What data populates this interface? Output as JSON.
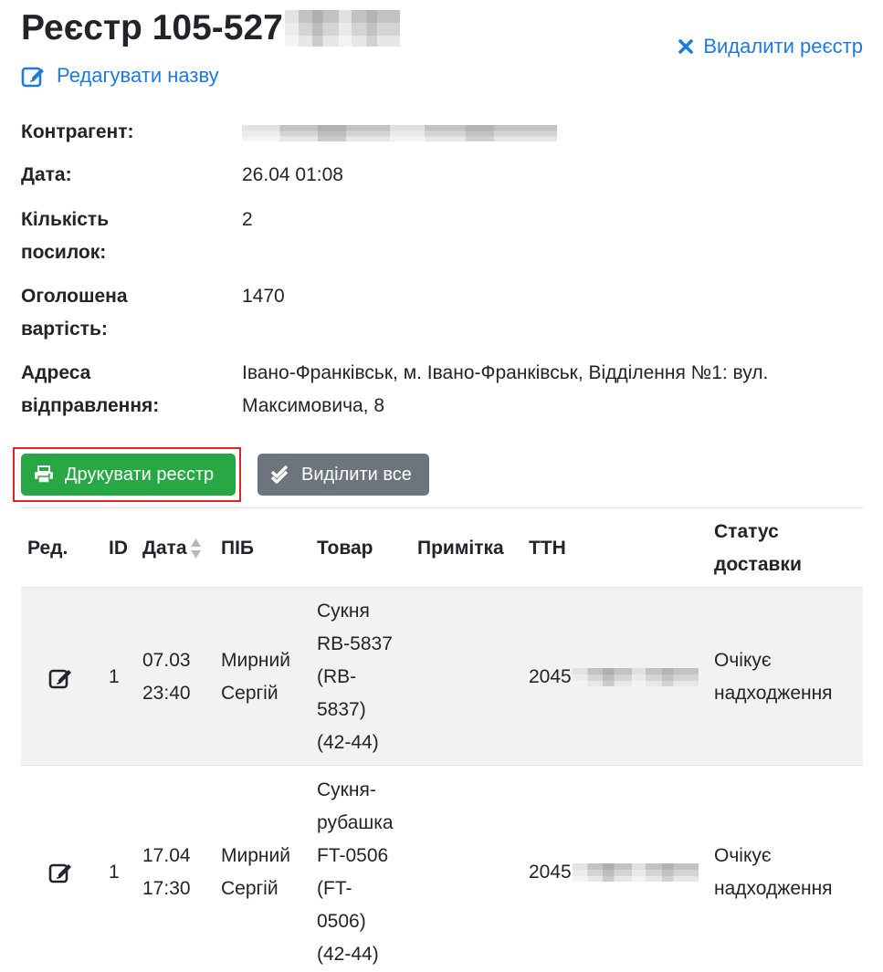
{
  "header": {
    "title_prefix": "Реєстр 105-527",
    "edit_name_label": "Редагувати назву",
    "delete_label": "Видалити реєстр"
  },
  "details": {
    "counterparty_label": "Контрагент:",
    "date_label": "Дата:",
    "date_value": "26.04 01:08",
    "parcels_label_1": "Кількість",
    "parcels_label_2": "посилок:",
    "parcels_value": "2",
    "declared_label_1": "Оголошена",
    "declared_label_2": "вартість:",
    "declared_value": "1470",
    "address_label_1": "Адреса",
    "address_label_2": "відправлення:",
    "address_value_1": "Івано-Франківськ, м. Івано-Франківськ, Відділення №1: вул.",
    "address_value_2": "Максимовича, 8"
  },
  "buttons": {
    "print_label": "Друкувати реєстр",
    "select_all_label": "Виділити все"
  },
  "table": {
    "headers": {
      "edit": "Ред.",
      "id": "ID",
      "date": "Дата",
      "name": "ПІБ",
      "product": "Товар",
      "note": "Примітка",
      "ttn": "ТТН",
      "status_1": "Статус",
      "status_2": "доставки"
    },
    "rows": [
      {
        "id": "1",
        "date_1": "07.03",
        "date_2": "23:40",
        "name_1": "Мирний",
        "name_2": "Сергій",
        "product_lines": [
          "Сукня",
          "RB-5837",
          "(RB-",
          "5837)",
          "(42-44)"
        ],
        "note": "",
        "ttn_prefix": "2045",
        "status_1": "Очікує",
        "status_2": "надходження"
      },
      {
        "id": "1",
        "date_1": "17.04",
        "date_2": "17:30",
        "name_1": "Мирний",
        "name_2": "Сергій",
        "product_lines": [
          "Сукня-",
          "рубашка",
          "FT-0506",
          "(FT-",
          "0506)",
          "(42-44)"
        ],
        "note": "",
        "ttn_prefix": "2045",
        "status_1": "Очікує",
        "status_2": "надходження"
      }
    ]
  },
  "colors": {
    "link": "#1f7ae0",
    "print_button": "#28a745",
    "select_button": "#6c757d",
    "highlight_border": "#e02424",
    "row_stripe": "#f2f2f2"
  },
  "icons": {
    "edit_name": "pen-square-icon",
    "delete": "close-icon",
    "print": "printer-icon",
    "select_all": "double-check-icon",
    "sort": "sort-icon",
    "row_edit": "edit-icon"
  }
}
